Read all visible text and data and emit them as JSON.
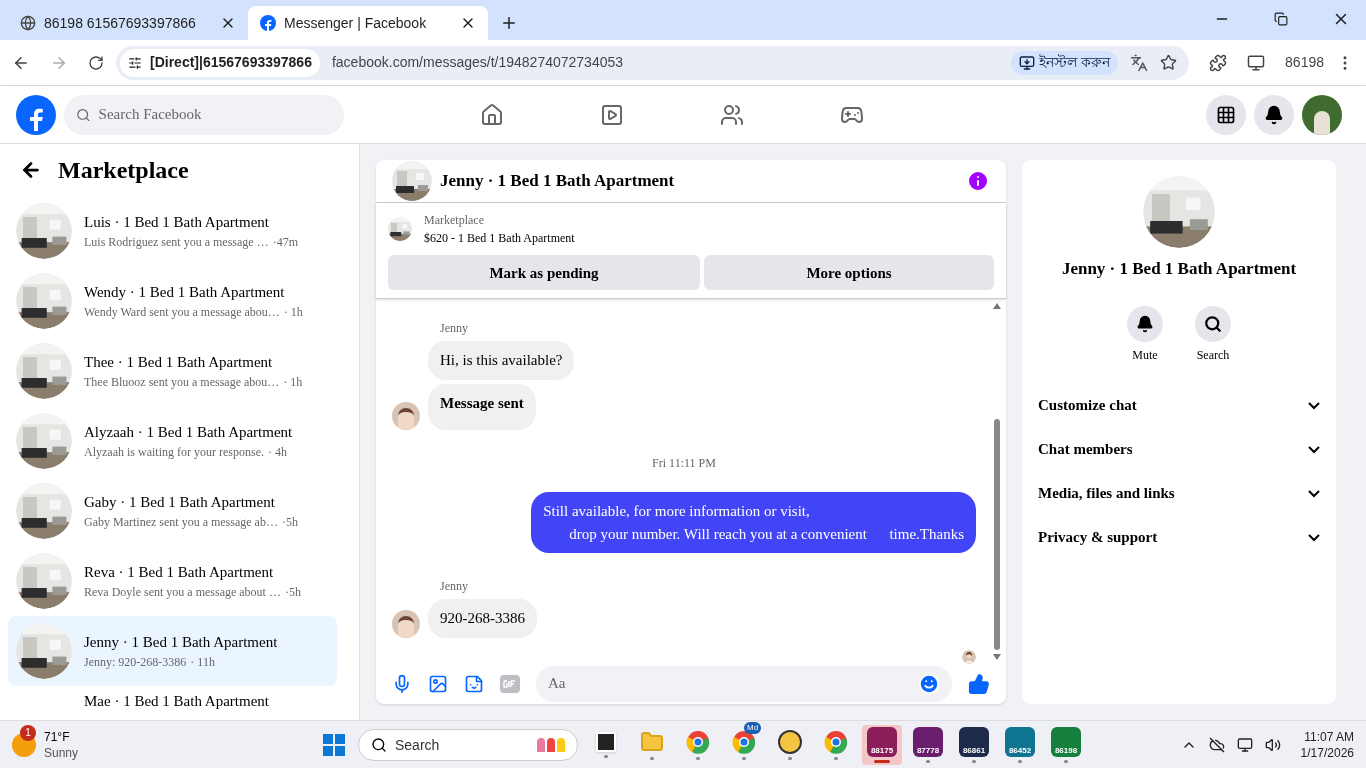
{
  "browser": {
    "tabs": [
      {
        "title": "86198 61567693397866",
        "kind": "globe",
        "selected": false
      },
      {
        "title": "Messenger | Facebook",
        "kind": "facebook",
        "selected": true
      }
    ],
    "site_chip": "[Direct]|61567693397866",
    "url": "facebook.com/messages/t/1948274072734053",
    "install_label": "ইনস্টল করুন",
    "profile_label": "86198"
  },
  "fb_header": {
    "search_placeholder": "Search Facebook"
  },
  "sidebar": {
    "title": "Marketplace",
    "conversations": [
      {
        "title": "Luis · 1 Bed 1 Bath Apartment",
        "preview": "Luis Rodriguez sent you a message …",
        "time": "·47m",
        "selected": false
      },
      {
        "title": "Wendy · 1 Bed 1 Bath Apartment",
        "preview": "Wendy Ward sent you a message abou…",
        "time": "· 1h",
        "selected": false
      },
      {
        "title": "Thee · 1 Bed 1 Bath Apartment",
        "preview": "Thee Bluooz sent you a message abou…",
        "time": "· 1h",
        "selected": false
      },
      {
        "title": "Alyzaah · 1 Bed 1 Bath Apartment",
        "preview": "Alyzaah is waiting for your response.",
        "time": "· 4h",
        "selected": false
      },
      {
        "title": "Gaby · 1 Bed 1 Bath Apartment",
        "preview": "Gaby Martinez sent you a message ab…",
        "time": "·5h",
        "selected": false
      },
      {
        "title": "Reva · 1 Bed 1 Bath Apartment",
        "preview": "Reva Doyle sent you a message about …",
        "time": "·5h",
        "selected": false
      },
      {
        "title": "Jenny · 1 Bed 1 Bath Apartment",
        "preview": "Jenny: 920-268-3386",
        "time": "· 11h",
        "selected": true
      },
      {
        "title": "Mae · 1 Bed 1 Bath Apartment",
        "selected": false
      }
    ]
  },
  "chat": {
    "title": "Jenny · 1 Bed 1 Bath Apartment",
    "listing": {
      "label": "Marketplace",
      "title": "$620 - 1 Bed 1 Bath Apartment",
      "buttons": [
        "Mark as pending",
        "More options"
      ]
    },
    "messages": [
      {
        "kind": "sender",
        "text": "Jenny"
      },
      {
        "kind": "incoming",
        "text": "Hi, is this available?",
        "bold": false,
        "avatar": false
      },
      {
        "kind": "incoming",
        "text": "Message sent",
        "bold": true,
        "avatar": true
      },
      {
        "kind": "timestamp",
        "text": "Fri 11:11 PM"
      },
      {
        "kind": "outgoing",
        "lines": [
          "Still available, for more information or visit,",
          "drop your number. Will reach you at a convenient      time.Thanks"
        ]
      },
      {
        "kind": "sender",
        "text": "Jenny"
      },
      {
        "kind": "incoming",
        "text": "920-268-3386",
        "bold": false,
        "avatar": true
      },
      {
        "kind": "seen"
      }
    ],
    "composer_placeholder": "Aa"
  },
  "details": {
    "title": "Jenny · 1 Bed 1 Bath Apartment",
    "actions": [
      {
        "kind": "bell",
        "label": "Mute"
      },
      {
        "kind": "search",
        "label": "Search"
      }
    ],
    "sections": [
      {
        "label": "Customize chat",
        "expanded": false
      },
      {
        "label": "Chat members",
        "expanded": false
      },
      {
        "label": "Media, files and links",
        "expanded": false
      },
      {
        "label": "Privacy & support",
        "expanded": false
      }
    ]
  },
  "taskbar": {
    "weather": {
      "badge": "1",
      "temp": "71°F",
      "condition": "Sunny"
    },
    "search_placeholder": "Search",
    "apps": [
      {
        "kind": "taskview",
        "active": false
      },
      {
        "kind": "folder",
        "active": false
      },
      {
        "kind": "chrome",
        "active": false
      },
      {
        "kind": "chrome",
        "badge": "Md",
        "active": false
      },
      {
        "kind": "ix",
        "active": false
      },
      {
        "kind": "chrome",
        "active": false
      },
      {
        "kind": "profile",
        "label": "88175",
        "color": "#8b1d5a",
        "active": true
      },
      {
        "kind": "profile",
        "label": "87778",
        "color": "#6b1e6e",
        "active": false
      },
      {
        "kind": "profile",
        "label": "86861",
        "color": "#1e2a4a",
        "active": false
      },
      {
        "kind": "profile",
        "label": "86452",
        "color": "#0e7490",
        "active": false
      },
      {
        "kind": "profile",
        "label": "86198",
        "color": "#15803d",
        "active": false
      }
    ],
    "time": "11:07 AM",
    "date": "1/17/2026"
  }
}
